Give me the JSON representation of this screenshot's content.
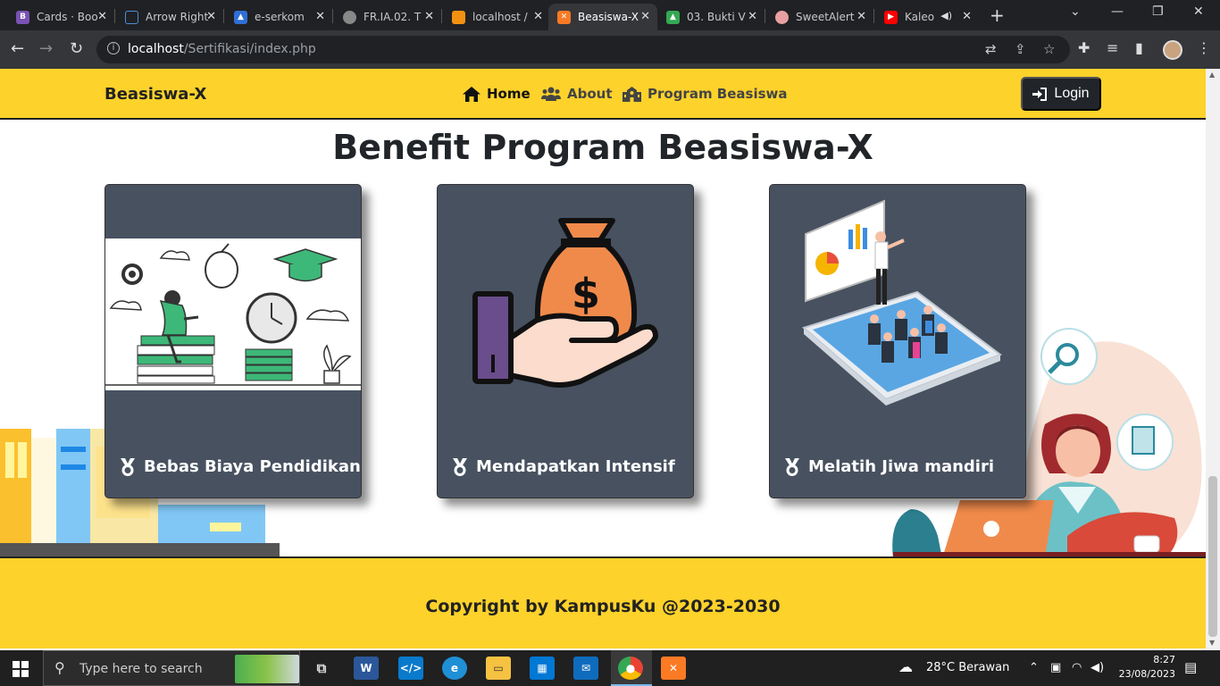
{
  "browser": {
    "tabs": [
      {
        "title": "Cards · Boo",
        "icon": "bootstrap-icon",
        "color": "#7952b3"
      },
      {
        "title": "Arrow Right",
        "icon": "flag-icon",
        "color": "#4a90d9"
      },
      {
        "title": "e-serkom",
        "icon": "triangle-logo-icon",
        "color": "#2f6fd6"
      },
      {
        "title": "FR.IA.02. T",
        "icon": "globe-icon",
        "color": "#888888"
      },
      {
        "title": "localhost /",
        "icon": "phpmyadmin-icon",
        "color": "#f29111"
      },
      {
        "title": "Beasiswa-X",
        "icon": "xampp-icon",
        "color": "#fb7a24",
        "active": true
      },
      {
        "title": "03. Bukti V",
        "icon": "google-drive-icon",
        "color": "#34a853"
      },
      {
        "title": "SweetAlert",
        "icon": "sweetalert-icon",
        "color": "#e8a0a0"
      },
      {
        "title": "Kaleo",
        "icon": "youtube-icon",
        "color": "#ff0000"
      }
    ],
    "url_host": "localhost",
    "url_path": "/Sertifikasi/index.php"
  },
  "navbar": {
    "brand": "Beasiswa-X",
    "links": [
      {
        "label": "Home",
        "icon": "home-icon",
        "active": true
      },
      {
        "label": "About",
        "icon": "users-icon"
      },
      {
        "label": "Program Beasiswa",
        "icon": "school-icon"
      }
    ],
    "login_label": "Login"
  },
  "main": {
    "title": "Benefit Program Beasiswa-X",
    "cards": [
      {
        "label": "Bebas Biaya Pendidikan",
        "icon": "medal-icon"
      },
      {
        "label": "Mendapatkan Intensif",
        "icon": "medal-icon"
      },
      {
        "label": "Melatih Jiwa mandiri",
        "icon": "medal-icon"
      }
    ]
  },
  "footer": {
    "copyright": "Copyright by KampusKu @2023-2030"
  },
  "taskbar": {
    "search_placeholder": "Type here to search",
    "weather": "28°C  Berawan",
    "time": "8:27",
    "date": "23/08/2023"
  },
  "colors": {
    "accent_yellow": "#fdd22b",
    "card_bg": "#475160",
    "dark": "#212529"
  }
}
